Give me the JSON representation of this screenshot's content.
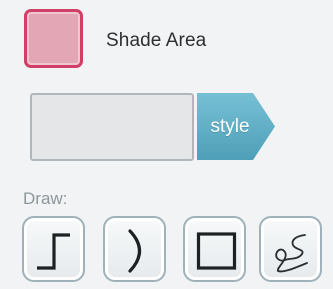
{
  "shade": {
    "label": "Shade Area",
    "swatch_color": "#e3a6b5",
    "border_color": "#cf3f67"
  },
  "style": {
    "button_label": "style",
    "button_color": "#5fb1c9"
  },
  "draw": {
    "label": "Draw:",
    "tools": [
      {
        "name": "step-line",
        "icon": "step-line-icon"
      },
      {
        "name": "curve",
        "icon": "curve-icon"
      },
      {
        "name": "rectangle",
        "icon": "rectangle-icon"
      },
      {
        "name": "freehand",
        "icon": "freehand-icon"
      }
    ]
  }
}
